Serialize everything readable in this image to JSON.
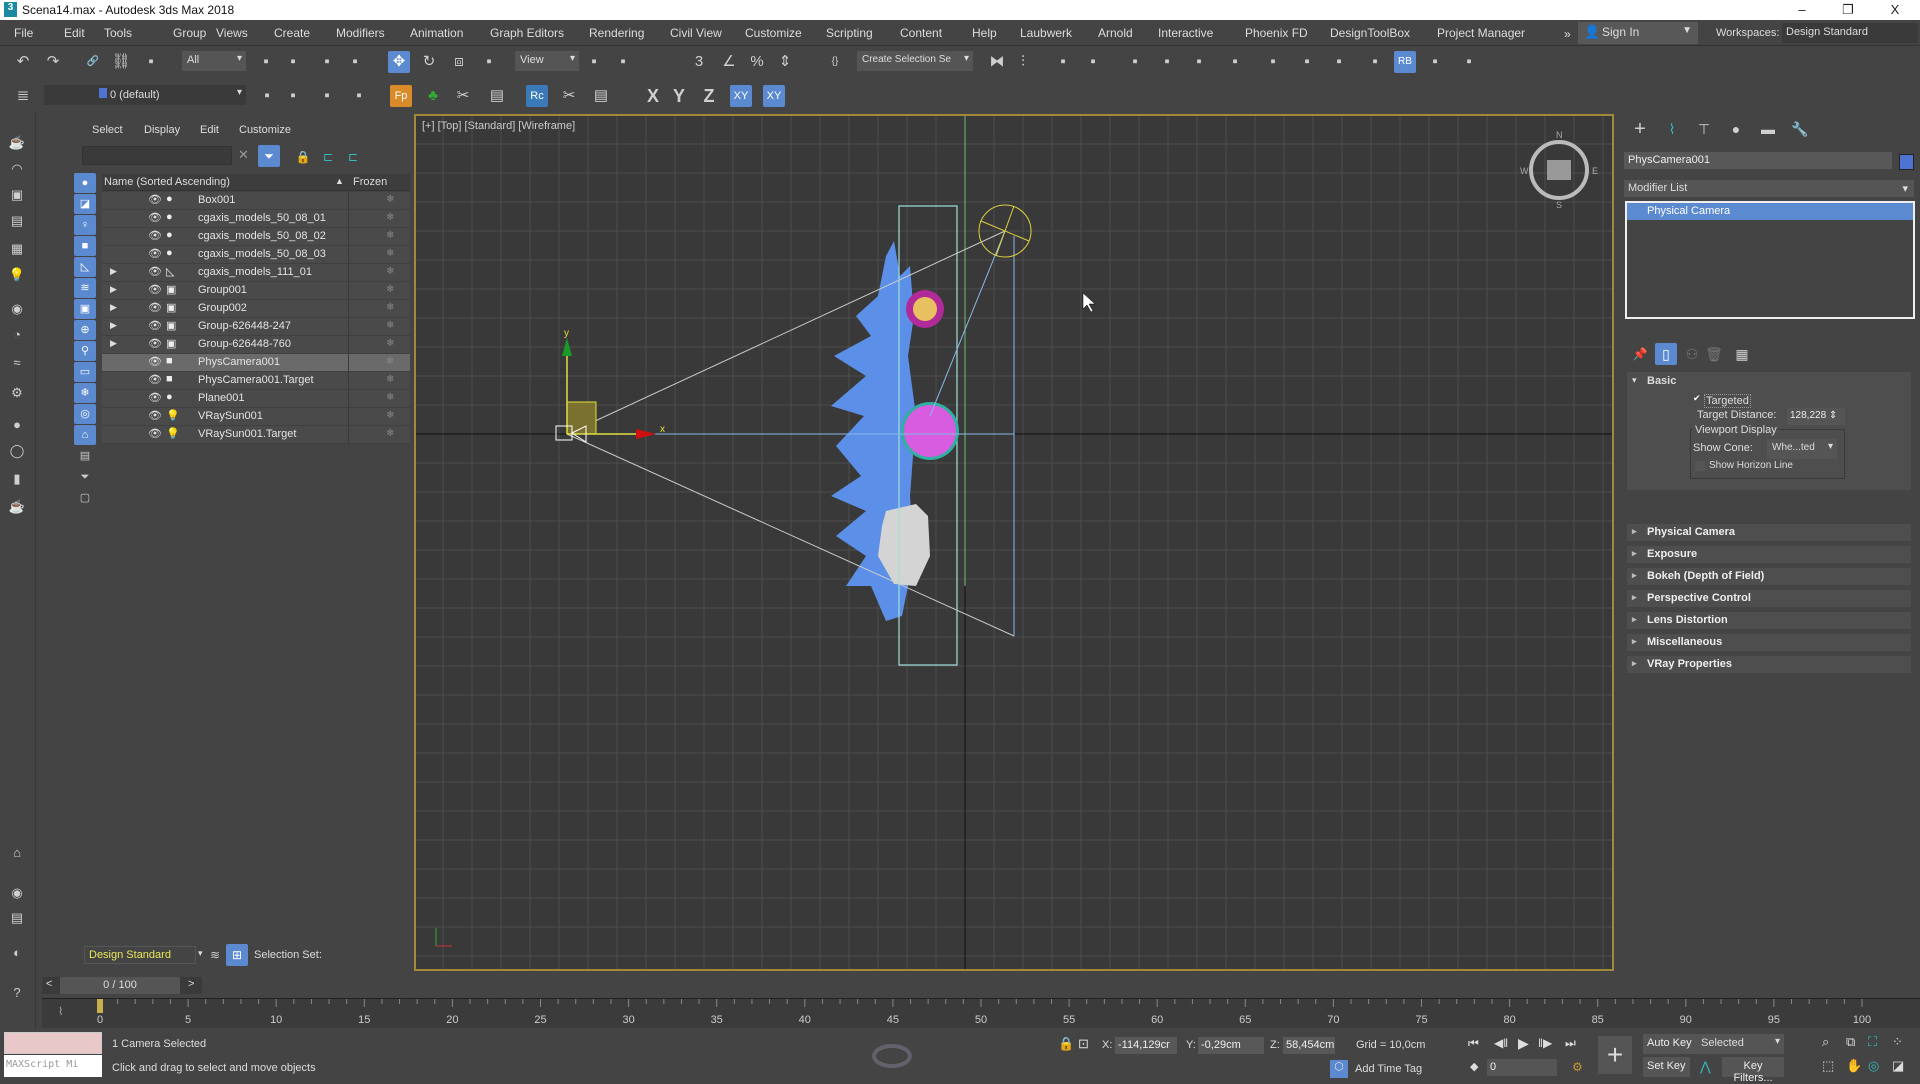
{
  "titlebar": {
    "title": "Scena14.max - Autodesk 3ds Max 2018",
    "minimize": "–",
    "restore": "❐",
    "close": "X"
  },
  "menubar": {
    "items": [
      "File",
      "Edit",
      "Tools",
      "Group",
      "Views",
      "Create",
      "Modifiers",
      "Animation",
      "Graph Editors",
      "Rendering",
      "Civil View",
      "Customize",
      "Scripting",
      "Content",
      "Help",
      "Laubwerk",
      "Arnold",
      "Interactive",
      "Phoenix FD",
      "DesignToolBox",
      "Project Manager"
    ],
    "overflow": "»",
    "sign_in": "Sign In",
    "workspaces_label": "Workspaces:",
    "workspace": "Design Standard"
  },
  "toolbar1": {
    "filter": "All",
    "ref_coord": "View",
    "selection_set": "Create Selection Se",
    "icons": [
      "undo-icon",
      "redo-icon",
      "link-icon",
      "unlink-icon",
      "bind-space-warp-icon",
      "select-object-icon",
      "select-by-name-icon",
      "rect-selection-icon",
      "window-crossing-icon",
      "select-move-icon",
      "select-rotate-icon",
      "select-scale-icon",
      "select-place-icon",
      "use-pivot-icon",
      "keyboard-shortcut-icon",
      "snaps-toggle-icon",
      "angle-snap-icon",
      "percent-snap-icon",
      "spinner-snap-icon",
      "named-selection-icon",
      "mirror-icon",
      "align-icon",
      "scene-explorer-icon",
      "layer-explorer-icon",
      "toggle-ribbon-icon",
      "curve-editor-icon",
      "schematic-view-icon",
      "material-editor-icon",
      "render-setup-icon",
      "rendered-frame-icon",
      "render-production-icon",
      "render-iterative-icon",
      "rb-icon",
      "vray-icon",
      "viewport-layout-icon"
    ]
  },
  "toolbar2": {
    "layer": "0 (default)",
    "axis_x": "X",
    "axis_y": "Y",
    "axis_z": "Z",
    "axis_xy": "XY",
    "axis_xy2": "XY",
    "icons": [
      "layer-manager-icon",
      "create-layer-icon",
      "add-to-layer-icon",
      "select-in-layer-icon",
      "layer-properties-icon",
      "forest-pack-icon",
      "tree-icon",
      "tools-icon",
      "list-icon",
      "railclone-icon",
      "rc-tools-icon",
      "rc-list-icon"
    ]
  },
  "explorer": {
    "menu": [
      "Select",
      "Display",
      "Edit",
      "Customize"
    ],
    "search_value": "",
    "col_name": "Name (Sorted Ascending)",
    "col_frozen": "Frozen",
    "rows": [
      {
        "name": "Box001",
        "type": "geometry",
        "expandable": false
      },
      {
        "name": "cgaxis_models_50_08_01",
        "type": "geometry",
        "expandable": false
      },
      {
        "name": "cgaxis_models_50_08_02",
        "type": "geometry",
        "expandable": false
      },
      {
        "name": "cgaxis_models_50_08_03",
        "type": "geometry",
        "expandable": false
      },
      {
        "name": "cgaxis_models_111_01",
        "type": "helper",
        "expandable": true
      },
      {
        "name": "Group001",
        "type": "group",
        "expandable": true
      },
      {
        "name": "Group002",
        "type": "group",
        "expandable": true
      },
      {
        "name": "Group-626448-247",
        "type": "group",
        "expandable": true
      },
      {
        "name": "Group-626448-760",
        "type": "group",
        "expandable": true
      },
      {
        "name": "PhysCamera001",
        "type": "camera",
        "expandable": false,
        "selected": true
      },
      {
        "name": "PhysCamera001.Target",
        "type": "camera",
        "expandable": false
      },
      {
        "name": "Plane001",
        "type": "geometry",
        "expandable": false
      },
      {
        "name": "VRaySun001",
        "type": "light",
        "expandable": false
      },
      {
        "name": "VRaySun001.Target",
        "type": "light",
        "expandable": false
      }
    ],
    "workspace": "Design Standard",
    "selection_set_label": "Selection Set:"
  },
  "viewport": {
    "label": "[+] [Top] [Standard] [Wireframe]",
    "axis_x": "x",
    "axis_y": "y",
    "compass": {
      "n": "N",
      "s": "S",
      "e": "E",
      "w": "W"
    }
  },
  "command_panel": {
    "object_name": "PhysCamera001",
    "object_color": "#4f73d0",
    "modifier_list": "Modifier List",
    "stack": [
      "Physical Camera"
    ],
    "basic": {
      "title": "Basic",
      "targeted_label": "Targeted",
      "targeted": true,
      "target_distance_label": "Target Distance:",
      "target_distance": "128,228",
      "viewport_display": "Viewport Display",
      "show_cone_label": "Show Cone:",
      "show_cone": "Whe...ted",
      "show_horizon": "Show Horizon Line"
    },
    "rollouts": [
      "Physical Camera",
      "Exposure",
      "Bokeh (Depth of Field)",
      "Perspective Control",
      "Lens Distortion",
      "Miscellaneous",
      "VRay Properties"
    ]
  },
  "timeline": {
    "slider": "0 / 100",
    "prev": "<",
    "next": ">",
    "start": 0,
    "end": 100,
    "current": 0
  },
  "status": {
    "maxscript": "MAXScript Mi",
    "selection": "1 Camera Selected",
    "prompt": "Click and drag to select and move objects",
    "x_label": "X:",
    "x": "-114,129cr",
    "y_label": "Y:",
    "y": "-0,29cm",
    "z_label": "Z:",
    "z": "58,454cm",
    "grid": "Grid = 10,0cm",
    "add_time_tag": "Add Time Tag",
    "auto_key": "Auto Key",
    "set_key": "Set Key",
    "key_mode": "Selected",
    "key_filters": "Key Filters...",
    "frame": "0"
  },
  "colors": {
    "accent": "#5b8ad0",
    "viewport_border": "#a08a3a",
    "selection_bg": "#6a6a6a"
  }
}
